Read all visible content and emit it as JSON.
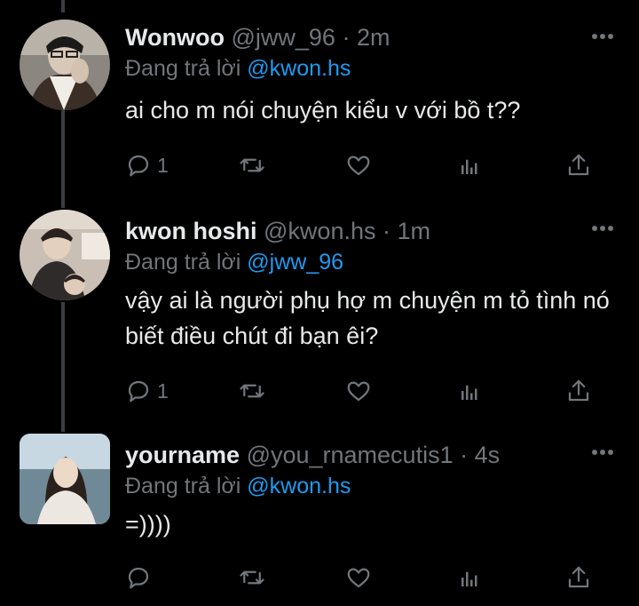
{
  "tweets": [
    {
      "name": "Wonwoo",
      "handle": "@jww_96",
      "time": "· 2m",
      "reply_prefix": "Đang trả lời",
      "reply_to": "@kwon.hs",
      "text": "ai cho m nói chuyện kiểu v với bồ t??",
      "reply_count": "1",
      "retweet_count": "",
      "like_count": ""
    },
    {
      "name": "kwon hoshi",
      "handle": "@kwon.hs",
      "time": "· 1m",
      "reply_prefix": "Đang trả lời",
      "reply_to": "@jww_96",
      "text": "vậy ai là người phụ hợ m chuyện m tỏ tình nó biết điều chút đi bạn êi?",
      "reply_count": "1",
      "retweet_count": "",
      "like_count": ""
    },
    {
      "name": "yourname",
      "handle": "@you_rnamecutis1",
      "time": "· 4s",
      "reply_prefix": "Đang trả lời",
      "reply_to": "@kwon.hs",
      "text": "=))))",
      "reply_count": "",
      "retweet_count": "",
      "like_count": ""
    }
  ],
  "colors": {
    "background": "#000000",
    "text": "#e7e9ea",
    "muted": "#71767b",
    "mention": "#1d9bf0",
    "thread_line": "#3a3d40"
  },
  "icons": [
    "reply-icon",
    "retweet-icon",
    "like-icon",
    "analytics-icon",
    "share-icon",
    "more-icon"
  ]
}
